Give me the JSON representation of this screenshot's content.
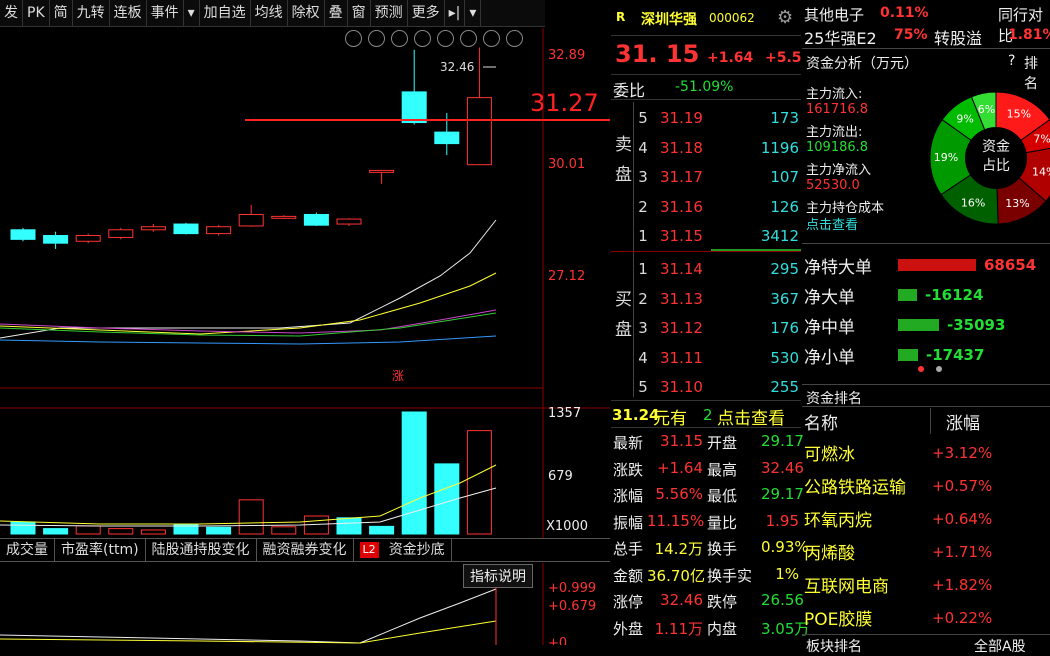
{
  "toolbar": {
    "items": [
      "发",
      "PK",
      "简",
      "九转",
      "连板",
      "事件",
      "▾",
      "加自选",
      "均线",
      "除权",
      "叠",
      "窗",
      "预测",
      "更多",
      "▸|",
      "▾"
    ]
  },
  "price_axis": {
    "labels": [
      "32.89",
      "30.01",
      "27.12"
    ],
    "current_price_line": "31.27",
    "high_marker": "32.46"
  },
  "volume_axis": {
    "labels": [
      "1357",
      "679",
      "X1000"
    ]
  },
  "zhang_marker": "涨",
  "bottom_tabs": [
    "成交量",
    "市盈率(ttm)",
    "陆股通持股变化",
    "融资融券变化",
    "L2",
    "资金抄底"
  ],
  "indicator_button": "指标说明",
  "indicator_axis": [
    "+0.999",
    "+0.679",
    "+0"
  ],
  "stock": {
    "badge": "R",
    "name": "深圳华强",
    "code": "000062",
    "price": "31. 15",
    "change": "+1.64",
    "change_pct": "+5.5"
  },
  "weibi": {
    "label": "委比",
    "value": "-51.09%"
  },
  "order_book": {
    "sell_label": "卖盘",
    "buy_label": "买盘",
    "sell": [
      {
        "level": "5",
        "price": "31.19",
        "volume": "173"
      },
      {
        "level": "4",
        "price": "31.18",
        "volume": "1196"
      },
      {
        "level": "3",
        "price": "31.17",
        "volume": "107"
      },
      {
        "level": "2",
        "price": "31.16",
        "volume": "126"
      },
      {
        "level": "1",
        "price": "31.15",
        "volume": "3412"
      }
    ],
    "buy": [
      {
        "level": "1",
        "price": "31.14",
        "volume": "295"
      },
      {
        "level": "2",
        "price": "31.13",
        "volume": "367"
      },
      {
        "level": "3",
        "price": "31.12",
        "volume": "176"
      },
      {
        "level": "4",
        "price": "31.11",
        "volume": "530"
      },
      {
        "level": "5",
        "price": "31.10",
        "volume": "255"
      }
    ]
  },
  "promo": {
    "value": "31.24",
    "text": "元有",
    "tail": "2",
    "link": "点击查看"
  },
  "quote_stats": [
    {
      "l1": "最新",
      "v1": "31.15",
      "l2": "开盘",
      "v2": "29.17"
    },
    {
      "l1": "涨跌",
      "v1": "+1.64",
      "l2": "最高",
      "v2": "32.46"
    },
    {
      "l1": "涨幅",
      "v1": "5.56%",
      "l2": "最低",
      "v2": "29.17"
    },
    {
      "l1": "振幅",
      "v1": "11.15%",
      "l2": "量比",
      "v2": "1.95"
    },
    {
      "l1": "总手",
      "v1": "14.2万",
      "l2": "换手",
      "v2": "0.93%"
    },
    {
      "l1": "金额",
      "v1": "36.70亿",
      "l2": "换手实",
      "v2": "1%"
    },
    {
      "l1": "涨停",
      "v1": "32.46",
      "l2": "跌停",
      "v2": "26.56"
    },
    {
      "l1": "外盘",
      "v1": "1.11万",
      "l2": "内盘",
      "v2": "3.05万"
    }
  ],
  "sector": {
    "name": "其他电子",
    "change": "0.11%",
    "right": "同行对比"
  },
  "bond": {
    "name": "25华强E2",
    "pct": "75%",
    "label": "转股溢",
    "value": "1.81%"
  },
  "fund_analysis": {
    "title": "资金分析（万元）",
    "help": "?",
    "rank": "排名",
    "inflow_label": "主力流入:",
    "inflow": "161716.8",
    "outflow_label": "主力流出:",
    "outflow": "109186.8",
    "net_label": "主力净流入",
    "net": "52530.0",
    "cost_label": "主力持仓成本",
    "link": "点击查看",
    "pie_center1": "资金",
    "pie_center2": "占比",
    "pie": [
      {
        "label": "15%",
        "value": 15,
        "color": "#ff1a1a"
      },
      {
        "label": "7%",
        "value": 7,
        "color": "#d40000"
      },
      {
        "label": "14%",
        "value": 14,
        "color": "#b00000"
      },
      {
        "label": "13%",
        "value": 13,
        "color": "#7a0000"
      },
      {
        "label": "16%",
        "value": 16,
        "color": "#006000"
      },
      {
        "label": "19%",
        "value": 19,
        "color": "#009900"
      },
      {
        "label": "9%",
        "value": 9,
        "color": "#00bb00"
      },
      {
        "label": "6%",
        "value": 6,
        "color": "#33dd33"
      }
    ]
  },
  "net_flows": [
    {
      "label": "净特大单",
      "value": "68654",
      "color": "#cc1111",
      "share": 0.78
    },
    {
      "label": "净大单",
      "value": "-16124",
      "color": "#22aa22",
      "share": 0.19
    },
    {
      "label": "净中单",
      "value": "-35093",
      "color": "#22aa22",
      "share": 0.41
    },
    {
      "label": "净小单",
      "value": "-17437",
      "color": "#22aa22",
      "share": 0.2
    }
  ],
  "rank": {
    "title": "资金排名",
    "col_name": "名称",
    "col_change": "涨幅",
    "rows": [
      {
        "name": "可燃冰",
        "change": "+3.12%"
      },
      {
        "name": "公路铁路运输",
        "change": "+0.57%"
      },
      {
        "name": "环氧丙烷",
        "change": "+0.64%"
      },
      {
        "name": "丙烯酸",
        "change": "+1.71%"
      },
      {
        "name": "互联网电商",
        "change": "+1.82%"
      },
      {
        "name": "POE胶膜",
        "change": "+0.22%"
      }
    ],
    "footer": "板块排名",
    "footer2": "全部A股"
  },
  "candles": [
    {
      "o": 27.7,
      "c": 27.45,
      "h": 27.75,
      "l": 27.4
    },
    {
      "o": 27.55,
      "c": 27.35,
      "h": 27.65,
      "l": 27.2
    },
    {
      "o": 27.4,
      "c": 27.55,
      "h": 27.6,
      "l": 27.35
    },
    {
      "o": 27.5,
      "c": 27.7,
      "h": 27.75,
      "l": 27.45
    },
    {
      "o": 27.7,
      "c": 27.78,
      "h": 27.85,
      "l": 27.65
    },
    {
      "o": 27.85,
      "c": 27.6,
      "h": 27.88,
      "l": 27.58
    },
    {
      "o": 27.6,
      "c": 27.78,
      "h": 27.82,
      "l": 27.55
    },
    {
      "o": 27.8,
      "c": 28.1,
      "h": 28.35,
      "l": 27.78
    },
    {
      "o": 28.0,
      "c": 28.05,
      "h": 28.08,
      "l": 27.98
    },
    {
      "o": 28.1,
      "c": 27.82,
      "h": 28.15,
      "l": 27.8
    },
    {
      "o": 27.85,
      "c": 27.98,
      "h": 28.0,
      "l": 27.8
    },
    {
      "o": 29.2,
      "c": 29.25,
      "h": 29.2,
      "l": 28.9
    },
    {
      "o": 31.3,
      "c": 30.5,
      "h": 32.4,
      "l": 30.45
    },
    {
      "o": 30.25,
      "c": 29.95,
      "h": 30.75,
      "l": 29.65
    },
    {
      "o": 29.4,
      "c": 31.15,
      "h": 32.46,
      "l": 29.4
    }
  ],
  "volumes": [
    {
      "v": 130,
      "up": false
    },
    {
      "v": 60,
      "up": false
    },
    {
      "v": 90,
      "up": true
    },
    {
      "v": 60,
      "up": true
    },
    {
      "v": 45,
      "up": true
    },
    {
      "v": 100,
      "up": false
    },
    {
      "v": 75,
      "up": false
    },
    {
      "v": 380,
      "up": true
    },
    {
      "v": 80,
      "up": true
    },
    {
      "v": 200,
      "up": true
    },
    {
      "v": 180,
      "up": false
    },
    {
      "v": 85,
      "up": false
    },
    {
      "v": 1357,
      "up": false
    },
    {
      "v": 780,
      "up": false
    },
    {
      "v": 1150,
      "up": true
    }
  ]
}
